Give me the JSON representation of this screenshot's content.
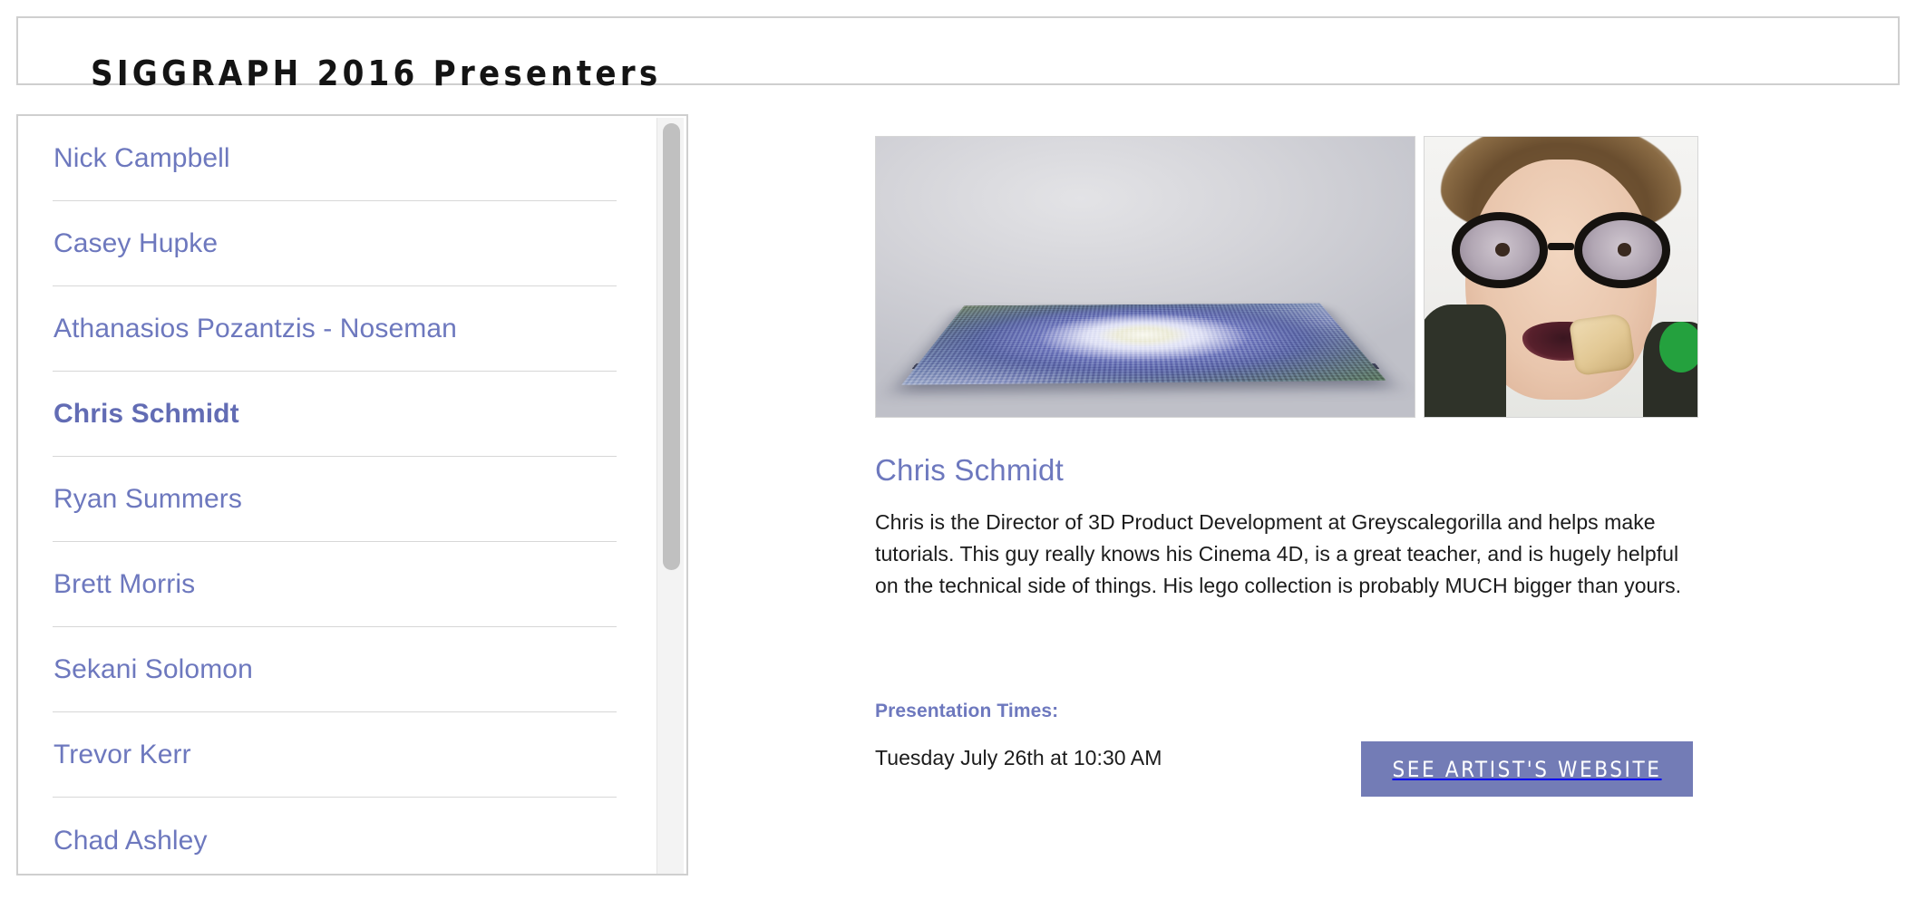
{
  "header": {
    "title": "SIGGRAPH 2016 Presenters"
  },
  "sidebar": {
    "selected": "Chris Schmidt",
    "items": [
      {
        "name": "Nick Campbell"
      },
      {
        "name": "Casey Hupke"
      },
      {
        "name": "Athanasios Pozantzis - Noseman"
      },
      {
        "name": "Chris Schmidt"
      },
      {
        "name": "Ryan Summers"
      },
      {
        "name": "Brett Morris"
      },
      {
        "name": "Sekani Solomon"
      },
      {
        "name": "Trevor Kerr"
      },
      {
        "name": "Chad Ashley"
      }
    ],
    "scrollbar": {
      "name": "vertical-scrollbar",
      "thumb_position_percent": 0,
      "thumb_size_percent": 59
    }
  },
  "detail": {
    "images": [
      {
        "alt": "3D voxel hurricane terrain render",
        "name": "artwork-image"
      },
      {
        "alt": "Portrait of presenter wearing thick round glasses with a chip in his mouth",
        "name": "presenter-portrait-image"
      }
    ],
    "name": "Chris Schmidt",
    "bio": "Chris is the Director of 3D Product Development at Greyscalegorilla and helps make tutorials. This guy really knows his Cinema 4D, is a great teacher, and is hugely helpful on the technical side of things. His lego collection is probably MUCH bigger than yours.",
    "times_label": "Presentation Times:",
    "times_value": "Tuesday July 26th at 10:30 AM",
    "website_button_label": "See Artist's Website"
  },
  "colors": {
    "link": "#6d78be",
    "heading_link": "#6d78be",
    "button_background": "#737cb6",
    "button_text": "#ffffff",
    "border": "#cfcfcf",
    "divider": "#d7d7d7",
    "body_text": "#1b1b1b",
    "title_text": "#141414",
    "scrollbar_thumb": "#c0c0c0",
    "scrollbar_track": "#f3f3f3"
  }
}
